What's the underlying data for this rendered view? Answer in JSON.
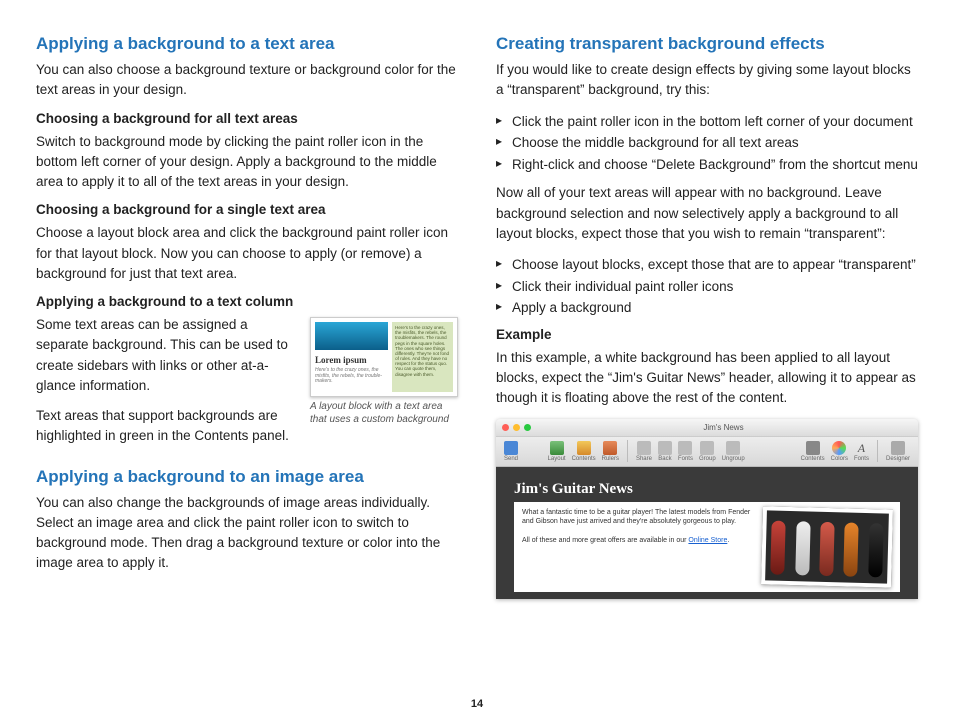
{
  "page_number": "14",
  "left": {
    "s1": {
      "title": "Applying a background to a text area",
      "p1": "You can also choose a background texture or background color for the text areas in your design.",
      "h1": "Choosing a background for all text areas",
      "p2": "Switch to background mode by clicking the paint roller icon in the bottom left corner of your design. Apply a background to the middle area to apply it to all of the text areas in your design.",
      "h2": "Choosing a background for a single text area",
      "p3": "Choose a layout block area and click the background paint roller icon for that layout block. Now you can choose to apply (or remove) a background for just that text area.",
      "h3": "Applying a background to a text column",
      "p4": "Some text areas can be assigned a separate background. This can be used to create sidebars with links or other at-a-glance information.",
      "p5": "Text areas that support backgrounds are highlighted in green in the Contents panel.",
      "fig1": {
        "lorem_title": "Lorem ipsum",
        "lorem_sub": "Here's to the crazy ones, the misfits, the rebels, the trouble-makers.",
        "side_text": "Here's to the crazy ones, the misfits, the rebels, the troublemakers. The round pegs in the square holes. The ones who see things differently. They're not fond of rules. And they have no respect for the status quo. You can quote them, disagree with them.",
        "caption": "A layout block with a text area that uses a custom background"
      }
    },
    "s2": {
      "title": "Applying a background to an image area",
      "p1": "You can also change the backgrounds of image areas individually. Select an image area and click the paint roller icon to switch to background mode. Then drag a background texture or color into the image area to apply it."
    }
  },
  "right": {
    "s1": {
      "title": "Creating transparent background effects",
      "p1": "If you would like to create design effects by giving some layout blocks a “transparent” background, try this:",
      "list1": [
        "Click the paint roller icon in the bottom left corner of your document",
        "Choose the middle background for all text areas",
        "Right-click and choose “Delete Background” from the shortcut menu"
      ],
      "p2": "Now all of your text areas will appear with no background. Leave background selection and now selectively apply a background to all layout blocks, expect those that you wish to remain “transparent”:",
      "list2": [
        "Choose layout blocks, except those that are to appear “transparent”",
        "Click their individual paint roller icons",
        "Apply a background"
      ],
      "h_example": "Example",
      "p3": "In this example, a white background has been applied to all layout blocks, expect the “Jim's Guitar News” header, allowing it to appear as though it is floating above the rest of the content."
    },
    "app": {
      "window_title": "Jim's News",
      "toolbar": {
        "send": "Send",
        "layout": "Layout",
        "contents": "Contents",
        "rulers": "Rulers",
        "share": "Share",
        "back": "Back",
        "fonts_btn": "Fonts",
        "group": "Group",
        "ungroup": "Ungroup",
        "contents2": "Contents",
        "colors": "Colors",
        "fonts2": "Fonts",
        "designer": "Designer"
      },
      "article": {
        "title": "Jim's Guitar News",
        "p1": "What a fantastic time to be a guitar player! The latest models from Fender and Gibson have just arrived and they're absolutely gorgeous to play.",
        "p2a": "All of these and more great offers are available in our ",
        "link": "Online Store",
        "p2b": "."
      }
    }
  }
}
